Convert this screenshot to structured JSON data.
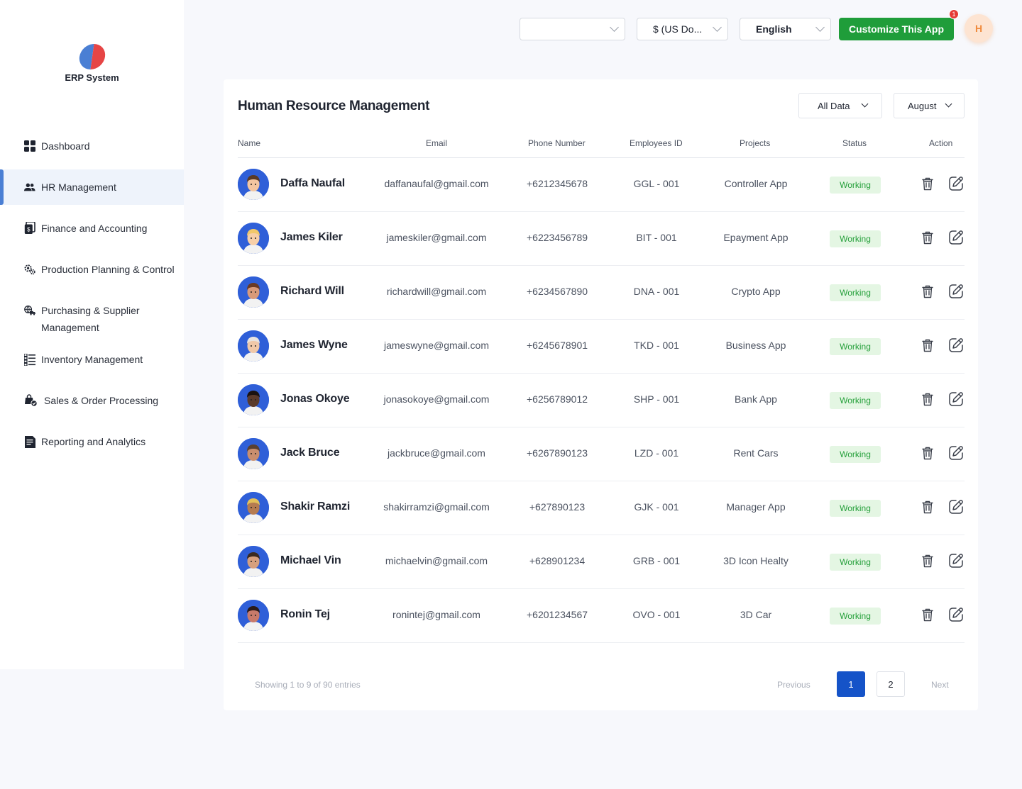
{
  "brand": {
    "name": "ERP System"
  },
  "sidebar": {
    "items": [
      {
        "label": "Dashboard",
        "icon": "grid-icon"
      },
      {
        "label": "HR Management",
        "icon": "users-icon"
      },
      {
        "label": "Finance and Accounting",
        "icon": "wallet-icon"
      },
      {
        "label": "Production Planning & Control",
        "icon": "gears-icon"
      },
      {
        "label": "Purchasing & Supplier Management",
        "icon": "truck-globe-icon"
      },
      {
        "label": "Inventory Management",
        "icon": "list-icon"
      },
      {
        "label": "Sales & Order Processing",
        "icon": "bag-check-icon"
      },
      {
        "label": "Reporting and Analytics",
        "icon": "report-icon"
      }
    ],
    "active_index": 1
  },
  "topbar": {
    "select1_value": "",
    "currency_value": "$ (US Do...",
    "language_value": "English",
    "customize_label": "Customize This App",
    "notification_count": "1",
    "user_initial": "H"
  },
  "main": {
    "title": "Human Resource Management",
    "filter_data": "All Data",
    "filter_month": "August",
    "columns": {
      "name": "Name",
      "email": "Email",
      "phone": "Phone Number",
      "employee_id": "Employees ID",
      "projects": "Projects",
      "status": "Status",
      "action": "Action"
    },
    "rows": [
      {
        "name": "Daffa Naufal",
        "email": "daffanaufal@gmail.com",
        "phone": "+6212345678",
        "id": "GGL - 001",
        "project": "Controller App",
        "status": "Working"
      },
      {
        "name": "James Kiler",
        "email": "jameskiler@gmail.com",
        "phone": "+6223456789",
        "id": "BIT - 001",
        "project": "Epayment App",
        "status": "Working"
      },
      {
        "name": "Richard Will",
        "email": "richardwill@gmail.com",
        "phone": "+6234567890",
        "id": "DNA - 001",
        "project": "Crypto App",
        "status": "Working"
      },
      {
        "name": "James Wyne",
        "email": "jameswyne@gmail.com",
        "phone": "+6245678901",
        "id": "TKD - 001",
        "project": "Business App",
        "status": "Working"
      },
      {
        "name": "Jonas Okoye",
        "email": "jonasokoye@gmail.com",
        "phone": "+6256789012",
        "id": "SHP - 001",
        "project": "Bank App",
        "status": "Working"
      },
      {
        "name": "Jack Bruce",
        "email": "jackbruce@gmail.com",
        "phone": "+6267890123",
        "id": "LZD - 001",
        "project": "Rent Cars",
        "status": "Working"
      },
      {
        "name": "Shakir Ramzi",
        "email": "shakirramzi@gmail.com",
        "phone": "+627890123",
        "id": "GJK - 001",
        "project": "Manager App",
        "status": "Working"
      },
      {
        "name": "Michael Vin",
        "email": "michaelvin@gmail.com",
        "phone": "+628901234",
        "id": "GRB - 001",
        "project": "3D Icon Healty",
        "status": "Working"
      },
      {
        "name": "Ronin Tej",
        "email": "ronintej@gmail.com",
        "phone": "+6201234567",
        "id": "OVO - 001",
        "project": "3D Car",
        "status": "Working"
      }
    ],
    "pagination": {
      "info": "Showing 1 to 9 of 90 entries",
      "prev_label": "Previous",
      "next_label": "Next",
      "pages": [
        "1",
        "2"
      ],
      "current": "1"
    }
  },
  "colors": {
    "accent": "#1553c8",
    "primary_button": "#1f9d3a",
    "status_working_bg": "#e4f6e3",
    "status_working_text": "#26a03b",
    "sidebar_active": "#4a7fd4"
  }
}
